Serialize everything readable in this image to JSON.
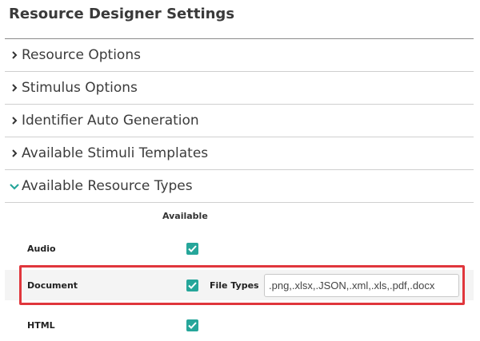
{
  "page": {
    "title": "Resource Designer Settings"
  },
  "accordion": {
    "items": [
      {
        "label": "Resource Options",
        "expanded": false
      },
      {
        "label": "Stimulus Options",
        "expanded": false
      },
      {
        "label": "Identifier Auto Generation",
        "expanded": false
      },
      {
        "label": "Available Stimuli Templates",
        "expanded": false
      },
      {
        "label": "Available Resource Types",
        "expanded": true
      }
    ]
  },
  "resource_types": {
    "column_header": "Available",
    "rows": [
      {
        "label": "Audio",
        "available": true
      },
      {
        "label": "Document",
        "available": true,
        "file_types_label": "File Types",
        "file_types_value": ".png,.xlsx,.JSON,.xml,.xls,.pdf,.docx"
      },
      {
        "label": "HTML",
        "available": true
      }
    ]
  },
  "colors": {
    "accent": "#26a69a",
    "highlight_border": "#e0363c"
  }
}
